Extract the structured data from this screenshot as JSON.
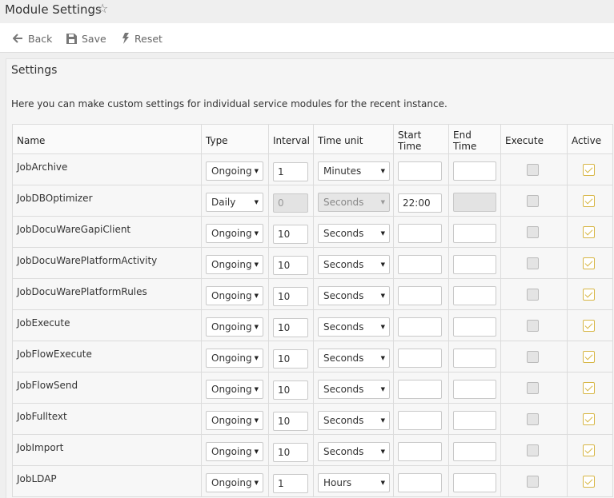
{
  "window": {
    "title": "Module Settings"
  },
  "toolbar": {
    "back": "Back",
    "save": "Save",
    "reset": "Reset"
  },
  "panel": {
    "title": "Settings",
    "description": "Here you can make custom settings for individual service modules for the recent instance."
  },
  "table": {
    "headers": {
      "name": "Name",
      "type": "Type",
      "interval": "Interval",
      "time_unit": "Time unit",
      "start_time": "Start Time",
      "end_time": "End Time",
      "execute": "Execute",
      "active": "Active"
    },
    "rows": [
      {
        "name": "JobArchive",
        "type": "Ongoing",
        "interval": "1",
        "unit": "Minutes",
        "start": "",
        "end": "",
        "execute": false,
        "active": true,
        "disabled": false
      },
      {
        "name": "JobDBOptimizer",
        "type": "Daily",
        "interval": "0",
        "unit": "Seconds",
        "start": "22:00",
        "end": "",
        "execute": false,
        "active": true,
        "disabled": true
      },
      {
        "name": "JobDocuWareGapiClient",
        "type": "Ongoing",
        "interval": "10",
        "unit": "Seconds",
        "start": "",
        "end": "",
        "execute": false,
        "active": true,
        "disabled": false
      },
      {
        "name": "JobDocuWarePlatformActivity",
        "type": "Ongoing",
        "interval": "10",
        "unit": "Seconds",
        "start": "",
        "end": "",
        "execute": false,
        "active": true,
        "disabled": false
      },
      {
        "name": "JobDocuWarePlatformRules",
        "type": "Ongoing",
        "interval": "10",
        "unit": "Seconds",
        "start": "",
        "end": "",
        "execute": false,
        "active": true,
        "disabled": false
      },
      {
        "name": "JobExecute",
        "type": "Ongoing",
        "interval": "10",
        "unit": "Seconds",
        "start": "",
        "end": "",
        "execute": false,
        "active": true,
        "disabled": false
      },
      {
        "name": "JobFlowExecute",
        "type": "Ongoing",
        "interval": "10",
        "unit": "Seconds",
        "start": "",
        "end": "",
        "execute": false,
        "active": true,
        "disabled": false
      },
      {
        "name": "JobFlowSend",
        "type": "Ongoing",
        "interval": "10",
        "unit": "Seconds",
        "start": "",
        "end": "",
        "execute": false,
        "active": true,
        "disabled": false
      },
      {
        "name": "JobFulltext",
        "type": "Ongoing",
        "interval": "10",
        "unit": "Seconds",
        "start": "",
        "end": "",
        "execute": false,
        "active": true,
        "disabled": false
      },
      {
        "name": "JobImport",
        "type": "Ongoing",
        "interval": "10",
        "unit": "Seconds",
        "start": "",
        "end": "",
        "execute": false,
        "active": true,
        "disabled": false
      },
      {
        "name": "JobLDAP",
        "type": "Ongoing",
        "interval": "1",
        "unit": "Hours",
        "start": "",
        "end": "",
        "execute": false,
        "active": true,
        "disabled": false
      }
    ]
  },
  "colors": {
    "accent": "#d7b645",
    "toolbar_text": "#666666"
  },
  "icons": {
    "title": "star-icon",
    "back": "arrow-left-icon",
    "save": "floppy-disk-icon",
    "reset": "lightning-bolt-icon"
  }
}
